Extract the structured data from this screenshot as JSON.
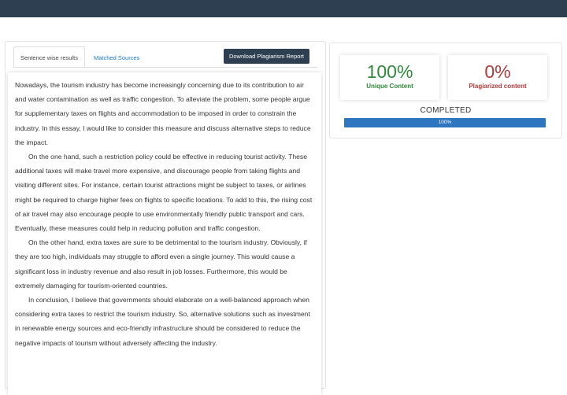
{
  "tabs": {
    "sentence_wise": "Sentence wise results",
    "matched_sources": "Matched Sources"
  },
  "download_button": "Download Plagiarism Report",
  "essay": {
    "paragraphs": [
      "Nowadays, the tourism industry has become increasingly concerning due to its contribution to air and water contamination as well as traffic congestion. To alleviate the problem, some people argue for supplementary taxes on flights and accommodation to be imposed in order to constrain the industry. In this essay, I would like to consider this measure and discuss alternative steps to reduce the impact.",
      "On the one hand, such a restriction policy could be effective in reducing tourist activity. These additional taxes will make travel more expensive, and discourage people from taking flights and visiting different sites. For instance, certain tourist attractions might be subject to taxes, or airlines might be required to charge higher fees on flights to specific locations. To add to this, the rising cost of air travel may also encourage people to use environmentally friendly public transport and cars. Eventually, these measures could help in reducing pollution and traffic congestion.",
      "On the other hand, extra taxes are sure to be detrimental to the tourism industry. Obviously, if they are too high, individuals may struggle to afford even a single journey. This would cause a significant loss in industry revenue and also result in job losses. Furthermore, this would be extremely damaging for tourism-oriented countries.",
      "In conclusion, I believe that governments should elaborate on a well-balanced approach when considering extra taxes to restrict the tourism industry. So, alternative solutions such as investment in renewable energy sources and eco-friendly infrastructure should be considered to reduce the negative impacts of tourism without adversely affecting the industry."
    ]
  },
  "results": {
    "unique_value": "100%",
    "unique_label": "Unique Content",
    "plagiarized_value": "0%",
    "plagiarized_label": "Plagiarized content",
    "status": "COMPLETED",
    "progress_label": "100%",
    "progress_fraction": 1.0
  },
  "colors": {
    "topbar": "#2f3f52",
    "unique": "#2f8a3a",
    "plagiarized": "#b33a3a",
    "progress": "#2e76bf"
  }
}
